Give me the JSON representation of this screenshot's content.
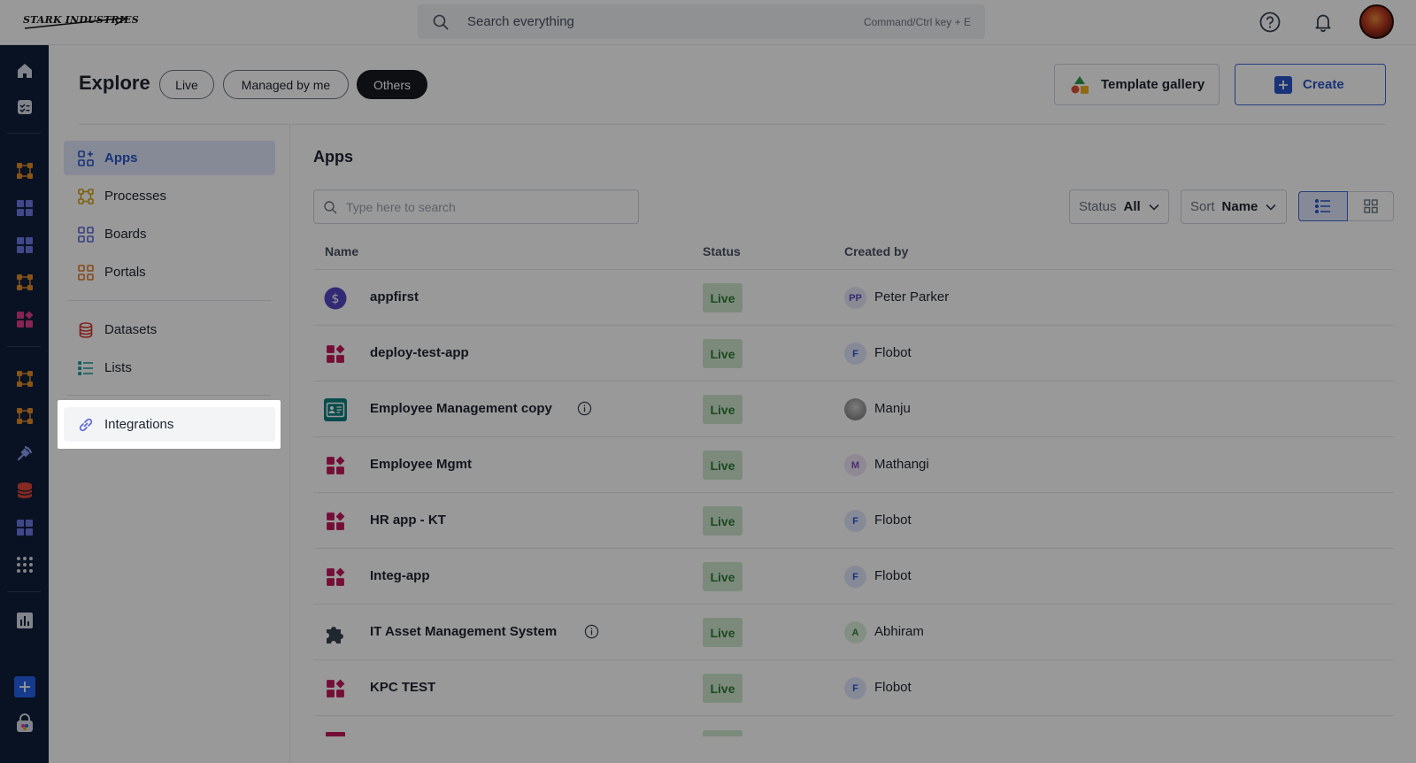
{
  "topbar": {
    "logo_text": "STARK INDUSTRIES",
    "search_text": "Search everything",
    "search_hint": "Command/Ctrl key + E"
  },
  "header": {
    "title": "Explore",
    "pills": [
      "Live",
      "Managed by me",
      "Others"
    ],
    "active_pill": "Others",
    "template_gallery_label": "Template gallery",
    "create_label": "Create"
  },
  "sidenav": {
    "items": [
      {
        "label": "Apps",
        "icon": "apps-icon",
        "active": true
      },
      {
        "label": "Processes",
        "icon": "processes-icon"
      },
      {
        "label": "Boards",
        "icon": "boards-icon"
      },
      {
        "label": "Portals",
        "icon": "portals-icon"
      },
      {
        "label": "Datasets",
        "icon": "datasets-icon"
      },
      {
        "label": "Lists",
        "icon": "lists-icon"
      },
      {
        "label": "Integrations",
        "icon": "integrations-icon"
      }
    ]
  },
  "main": {
    "title": "Apps",
    "search_placeholder": "Type here to search",
    "status_label": "Status",
    "status_value": "All",
    "sort_label": "Sort",
    "sort_value": "Name",
    "columns": [
      "Name",
      "Status",
      "Created by"
    ],
    "rows": [
      {
        "name": "appfirst",
        "icon": "dollar-icon",
        "status": "Live",
        "creator": "Peter Parker",
        "initials": "PP",
        "info": false
      },
      {
        "name": "deploy-test-app",
        "icon": "app-blocks-icon",
        "status": "Live",
        "creator": "Flobot",
        "initials": "F",
        "info": false
      },
      {
        "name": "Employee Management copy",
        "icon": "id-card-icon",
        "status": "Live",
        "creator": "Manju",
        "initials": "",
        "info": true
      },
      {
        "name": "Employee Mgmt",
        "icon": "app-blocks-icon",
        "status": "Live",
        "creator": "Mathangi",
        "initials": "M",
        "info": false
      },
      {
        "name": "HR app - KT",
        "icon": "app-blocks-icon",
        "status": "Live",
        "creator": "Flobot",
        "initials": "F",
        "info": false
      },
      {
        "name": "Integ-app",
        "icon": "app-blocks-icon",
        "status": "Live",
        "creator": "Flobot",
        "initials": "F",
        "info": false
      },
      {
        "name": "IT Asset Management System",
        "icon": "puzzle-icon",
        "status": "Live",
        "creator": "Abhiram",
        "initials": "A",
        "info": true
      },
      {
        "name": "KPC TEST",
        "icon": "app-blocks-icon",
        "status": "Live",
        "creator": "Flobot",
        "initials": "F",
        "info": false
      }
    ]
  },
  "colors": {
    "rail": "#0f1f3a",
    "accent": "#2a55c9",
    "live_bg": "#cfe6cf",
    "live_text": "#2f7a35",
    "app_icon": "#c2185b"
  }
}
